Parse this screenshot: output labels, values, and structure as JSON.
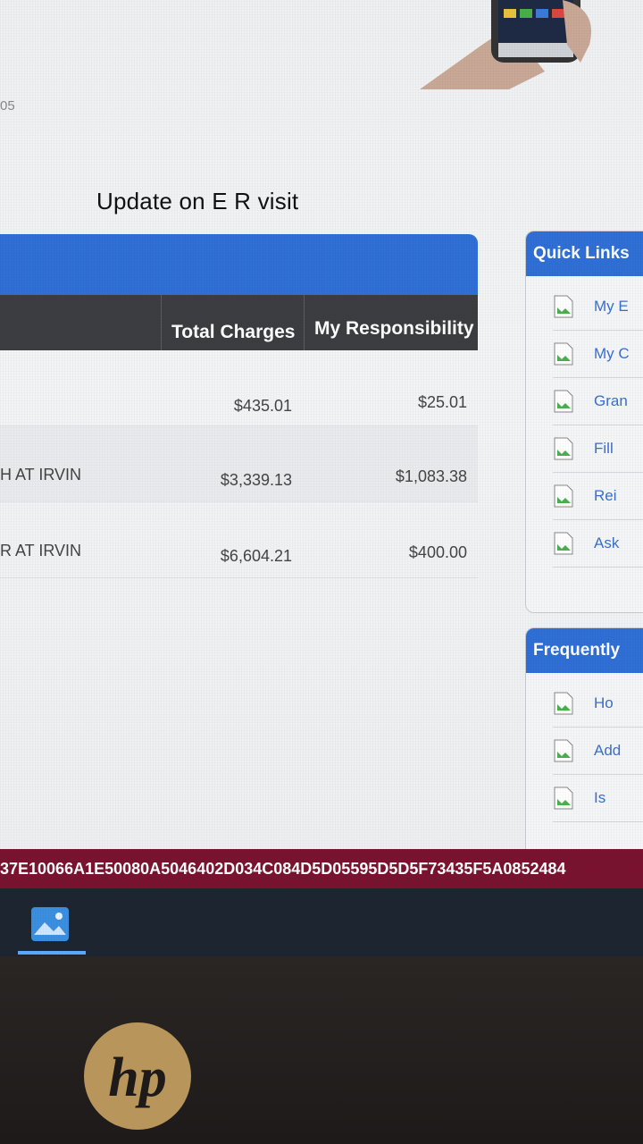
{
  "page": {
    "side_number": "05",
    "caption": "Update on E R visit"
  },
  "claims_table": {
    "headers": {
      "total_charges": "Total Charges",
      "my_responsibility": "My Responsibility"
    },
    "rows": [
      {
        "description": "",
        "total_charges": "$435.01",
        "my_responsibility": "$25.01"
      },
      {
        "description": "H AT IRVIN",
        "total_charges": "$3,339.13",
        "my_responsibility": "$1,083.38"
      },
      {
        "description": "R AT IRVIN",
        "total_charges": "$6,604.21",
        "my_responsibility": "$400.00"
      }
    ]
  },
  "quick_links": {
    "title": "Quick Links",
    "items": [
      {
        "label": "My E"
      },
      {
        "label": "My C"
      },
      {
        "label": "Gran"
      },
      {
        "label": "Fill"
      },
      {
        "label": "Rei"
      },
      {
        "label": "Ask"
      }
    ]
  },
  "faq": {
    "title": "Frequently",
    "items": [
      {
        "label": "Ho"
      },
      {
        "label": "Add"
      },
      {
        "label": "Is"
      }
    ]
  },
  "strip_text": "37E10066A1E50080A5046402D034C084D5D05595D5D5F73435F5A0852484",
  "taskbar": {
    "apps": [
      {
        "name": "photos",
        "icon": "photos-icon",
        "active": true
      }
    ]
  },
  "brand": {
    "logo": "hp",
    "logo_color": "#b8955a"
  },
  "colors": {
    "accent_blue": "#2f6fd6",
    "header_dark": "#3b3d40",
    "strip_red": "#7a1330"
  }
}
